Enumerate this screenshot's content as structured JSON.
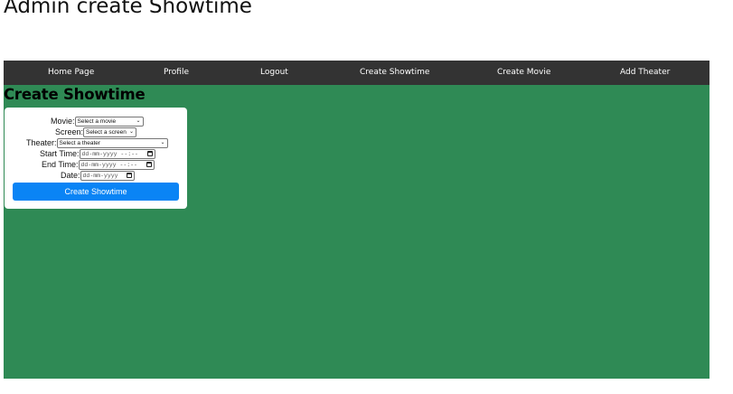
{
  "document": {
    "title": "Admin create Showtime"
  },
  "navbar": {
    "items": [
      {
        "label": "Home Page"
      },
      {
        "label": "Profile"
      },
      {
        "label": "Logout"
      },
      {
        "label": "Create Showtime"
      },
      {
        "label": "Create Movie"
      },
      {
        "label": "Add Theater"
      }
    ]
  },
  "page": {
    "heading": "Create Showtime",
    "background_color": "#2f8a55"
  },
  "form": {
    "movie_label": "Movie:",
    "movie_selected": "Select a movie",
    "screen_label": "Screen:",
    "screen_selected": "Select a screen",
    "theater_label": "Theater:",
    "theater_selected": "Select a theater",
    "start_time_label": "Start Time:",
    "start_time_value": "dd-mm-yyyy --:--",
    "end_time_label": "End Time:",
    "end_time_value": "dd-mm-yyyy --:--",
    "date_label": "Date:",
    "date_value": "dd-mm-yyyy",
    "submit_label": "Create Showtime",
    "submit_color": "#0a84f5"
  }
}
